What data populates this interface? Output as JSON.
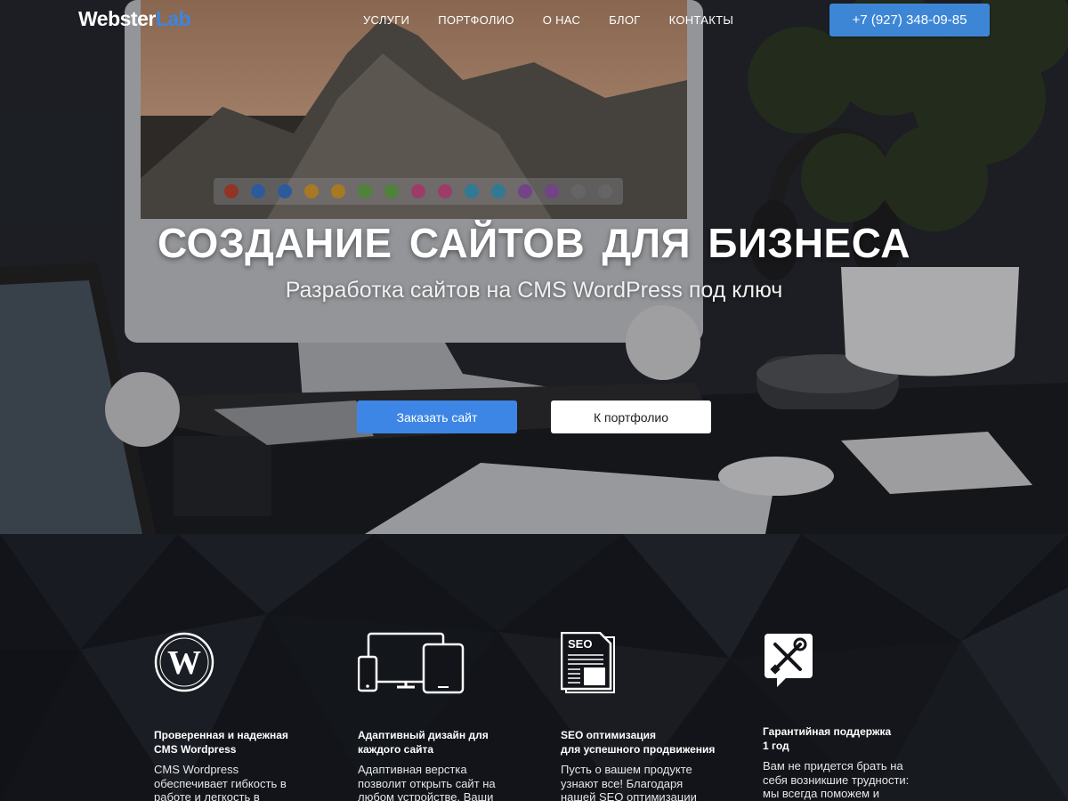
{
  "nav": {
    "logo_main": "Webster",
    "logo_accent": "Lab",
    "items": [
      {
        "label": "УСЛУГИ"
      },
      {
        "label": "ПОРТФОЛИО"
      },
      {
        "label": "О НАС"
      },
      {
        "label": "БЛОГ"
      },
      {
        "label": "КОНТАКТЫ"
      }
    ],
    "phone": "+7 (927) 348-09-85"
  },
  "hero": {
    "title": "СОЗДАНИЕ САЙТОВ ДЛЯ БИЗНЕСА",
    "subtitle": "Разработка сайтов на CMS WordPress под ключ",
    "order_button": "Заказать сайт",
    "portfolio_button": "К портфолио"
  },
  "features": [
    {
      "icon": "wordpress-icon",
      "title": "Проверенная и надежная\nCMS Wordpress",
      "desc": "CMS Wordpress обеспечивает гибкость в работе и легкость в управлении контентом."
    },
    {
      "icon": "devices-icon",
      "title": "Адаптивный дизайн для\nкаждого сайта",
      "desc": "Адаптивная верстка позволит открыть сайт на любом устройстве. Ваши"
    },
    {
      "icon": "seo-document-icon",
      "title": "SEO оптимизация\nдля успешного продвижения",
      "desc": "Пусть о вашем продукте узнают все! Благодаря нашей SEO оптимизации"
    },
    {
      "icon": "tools-support-icon",
      "title": "Гарантийная поддержка\n1 год",
      "desc": "Вам не придется брать на себя возникшие трудности: мы всегда поможем и"
    }
  ],
  "colors": {
    "accent": "#3d86e6",
    "features_bg": "#121419"
  }
}
